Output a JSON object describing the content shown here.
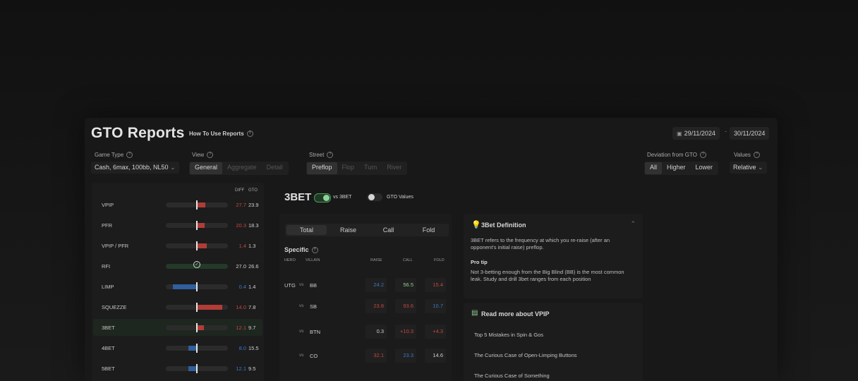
{
  "header": {
    "title": "GTO Reports",
    "how_to": "How To Use Reports",
    "help_icon": "?",
    "date_from": "29/11/2024",
    "date_sep": "-",
    "date_to": "30/11/2024",
    "calendar_icon": "calendar-icon"
  },
  "filters": {
    "game_type_label": "Game Type",
    "game_type_value": "Cash, 6max, 100bb, NL50",
    "view_label": "View",
    "view_options": [
      "General",
      "Aggregate",
      "Detail"
    ],
    "street_label": "Street",
    "street_options": [
      "Preflop",
      "Flop",
      "Turn",
      "River"
    ],
    "deviation_label": "Deviation from GTO",
    "deviation_options": [
      "All",
      "Higher",
      "Lower"
    ],
    "values_label": "Values",
    "values_value": "Relative",
    "chevron": "⌄"
  },
  "metrics": {
    "col_diff": "DIFF",
    "col_gto": "GTO",
    "rows": [
      {
        "name": "VPIP",
        "diff": "27.7",
        "gto": "23.9"
      },
      {
        "name": "PFR",
        "diff": "20.3",
        "gto": "18.3"
      },
      {
        "name": "VPIP / PFR",
        "diff": "1.4",
        "gto": "1.3"
      },
      {
        "name": "RFI",
        "diff": "27.0",
        "gto": "26.6"
      },
      {
        "name": "LIMP",
        "diff": "0.4",
        "gto": "1.4"
      },
      {
        "name": "SQUEZZE",
        "diff": "14.0",
        "gto": "7.8"
      },
      {
        "name": "3BET",
        "diff": "12.1",
        "gto": "9.7"
      },
      {
        "name": "4BET",
        "diff": "8.0",
        "gto": "15.5"
      },
      {
        "name": "5BET",
        "diff": "12.1",
        "gto": "9.5"
      }
    ],
    "ok_icon": "✓"
  },
  "detail": {
    "title": "3BET",
    "toggle1_label": "vs 3BET",
    "toggle2_label": "GTO Values",
    "tabs": [
      "Total",
      "Raise",
      "Call",
      "Fold"
    ],
    "specific": "Specific",
    "col_hero": "HERO",
    "col_villain": "VILLAIN",
    "col_raise": "RAISE",
    "col_call": "CALL",
    "col_fold": "FOLD",
    "rows": [
      {
        "hero": "UTG",
        "vs": "vs",
        "villain": "BB",
        "raise": "24.2",
        "call": "56.5",
        "fold": "15.4"
      },
      {
        "hero": "",
        "vs": "vs",
        "villain": "SB",
        "raise": "23.8",
        "call": "93.6",
        "fold": "10.7"
      },
      {
        "hero": "",
        "vs": "vs",
        "villain": "BTN",
        "raise": "0.3",
        "call": "+10.3",
        "fold": "+4.3"
      },
      {
        "hero": "",
        "vs": "vs",
        "villain": "CO",
        "raise": "32.1",
        "call": "23.3",
        "fold": "14.6"
      }
    ]
  },
  "info": {
    "def_icon": "💡",
    "def_title": "3Bet Definition",
    "def_text": "3BET refers to the frequency at which you re-raise (after an opponent's initial raise) preflop.",
    "tip_title": "Pro tip",
    "tip_text": "Not 3-betting enough from the Big Blind (BB) is the most common leak. Study and drill 3bet  ranges from each position",
    "collapse_icon": "⌃",
    "read_icon": "▤",
    "read_title": "Read more about VPIP",
    "links": [
      "Top 5 Mistakes in Spin & Gos",
      "The Curious Case of Open-Limping Buttons",
      "The Curious Case of Something"
    ]
  },
  "colors": {
    "red": "#c4463f",
    "blue": "#3a78c4",
    "green": "#4b9a5a"
  }
}
